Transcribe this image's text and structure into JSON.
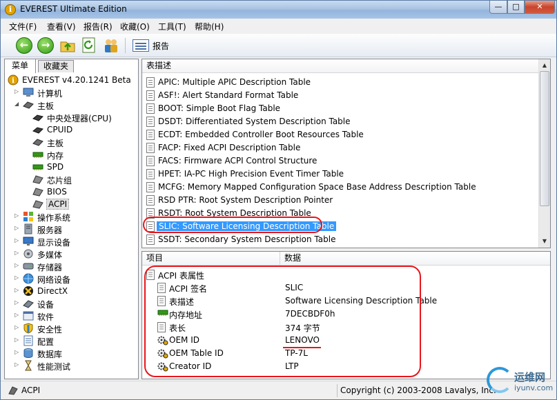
{
  "window": {
    "title": "EVEREST Ultimate Edition",
    "close": "✕",
    "max": "□",
    "min": "—"
  },
  "menu": [
    "文件(F)",
    "查看(V)",
    "报告(R)",
    "收藏(O)",
    "工具(T)",
    "帮助(H)"
  ],
  "toolbar": {
    "report_label": "报告",
    "back": "←",
    "forward": "→",
    "refresh": "↻"
  },
  "tabs": {
    "menu": "菜单",
    "favorites": "收藏夹"
  },
  "tree": [
    {
      "label": "EVEREST v4.20.1241 Beta",
      "level": 0,
      "expander": "",
      "icon": "info-icon"
    },
    {
      "label": "计算机",
      "level": 1,
      "expander": "▷",
      "icon": "computer-icon"
    },
    {
      "label": "主板",
      "level": 1,
      "expander": "◢",
      "icon": "motherboard-icon"
    },
    {
      "label": "中央处理器(CPU)",
      "level": 2,
      "expander": "",
      "icon": "cpu-icon"
    },
    {
      "label": "CPUID",
      "level": 2,
      "expander": "",
      "icon": "cpu-icon"
    },
    {
      "label": "主板",
      "level": 2,
      "expander": "",
      "icon": "motherboard-icon"
    },
    {
      "label": "内存",
      "level": 2,
      "expander": "",
      "icon": "memory-icon"
    },
    {
      "label": "SPD",
      "level": 2,
      "expander": "",
      "icon": "memory-icon"
    },
    {
      "label": "芯片组",
      "level": 2,
      "expander": "",
      "icon": "chipset-icon"
    },
    {
      "label": "BIOS",
      "level": 2,
      "expander": "",
      "icon": "chipset-icon"
    },
    {
      "label": "ACPI",
      "level": 2,
      "expander": "",
      "icon": "chipset-icon",
      "selected": true
    },
    {
      "label": "操作系统",
      "level": 1,
      "expander": "▷",
      "icon": "windows-icon"
    },
    {
      "label": "服务器",
      "level": 1,
      "expander": "▷",
      "icon": "server-icon"
    },
    {
      "label": "显示设备",
      "level": 1,
      "expander": "▷",
      "icon": "display-icon"
    },
    {
      "label": "多媒体",
      "level": 1,
      "expander": "▷",
      "icon": "multimedia-icon"
    },
    {
      "label": "存储器",
      "level": 1,
      "expander": "▷",
      "icon": "storage-icon"
    },
    {
      "label": "网络设备",
      "level": 1,
      "expander": "▷",
      "icon": "network-icon"
    },
    {
      "label": "DirectX",
      "level": 1,
      "expander": "▷",
      "icon": "directx-icon"
    },
    {
      "label": "设备",
      "level": 1,
      "expander": "▷",
      "icon": "devices-icon"
    },
    {
      "label": "软件",
      "level": 1,
      "expander": "▷",
      "icon": "software-icon"
    },
    {
      "label": "安全性",
      "level": 1,
      "expander": "▷",
      "icon": "security-icon"
    },
    {
      "label": "配置",
      "level": 1,
      "expander": "▷",
      "icon": "config-icon"
    },
    {
      "label": "数据库",
      "level": 1,
      "expander": "▷",
      "icon": "database-icon"
    },
    {
      "label": "性能测试",
      "level": 1,
      "expander": "▷",
      "icon": "benchmark-icon"
    }
  ],
  "table_list": {
    "header": "表描述",
    "rows": [
      "APIC: Multiple APIC Description Table",
      "ASF!: Alert Standard Format Table",
      "BOOT: Simple Boot Flag Table",
      "DSDT: Differentiated System Description Table",
      "ECDT: Embedded Controller Boot Resources Table",
      "FACP: Fixed ACPI Description Table",
      "FACS: Firmware ACPI Control Structure",
      "HPET: IA-PC High Precision Event Timer Table",
      "MCFG: Memory Mapped Configuration Space Base Address Description Table",
      "RSD PTR: Root System Description Pointer",
      "RSDT: Root System Description Table",
      "SLIC: Software Licensing Description Table",
      "SSDT: Secondary System Description Table"
    ],
    "selected_index": 11
  },
  "properties": {
    "col_item": "项目",
    "col_data": "数据",
    "group": "ACPI 表属性",
    "rows": [
      {
        "name": "ACPI 签名",
        "value": "SLIC",
        "icon": "document-icon"
      },
      {
        "name": "表描述",
        "value": "Software Licensing Description Table",
        "icon": "document-icon"
      },
      {
        "name": "内存地址",
        "value": "7DECBDF0h",
        "icon": "memory-icon"
      },
      {
        "name": "表长",
        "value": "374 字节",
        "icon": "document-icon"
      },
      {
        "name": "OEM ID",
        "value": "LENOVO",
        "icon": "gears-icon"
      },
      {
        "name": "OEM Table ID",
        "value": "TP-7L",
        "icon": "gears-icon"
      },
      {
        "name": "Creator ID",
        "value": "LTP",
        "icon": "gears-icon"
      }
    ]
  },
  "status": {
    "left": "ACPI",
    "right": "Copyright (c) 2003-2008 Lavalys, Inc."
  },
  "watermark": {
    "line1": "运维网",
    "line2": "iyunv.com"
  },
  "colors": {
    "selection": "#3399ff",
    "annotation": "#e8141a",
    "title_gradient": "#a9c4e4"
  }
}
